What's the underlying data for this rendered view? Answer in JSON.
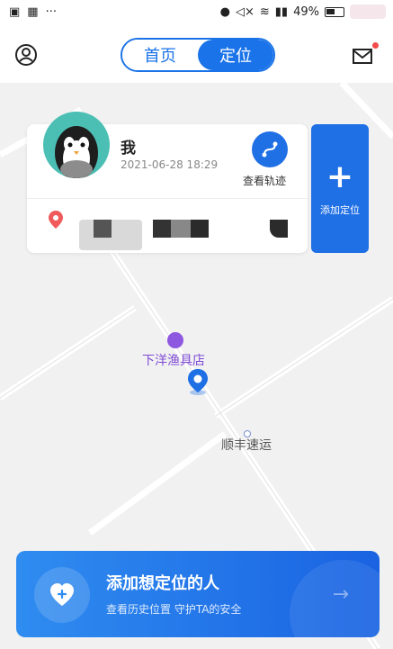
{
  "status_bar": {
    "battery": "49%"
  },
  "header": {
    "tabs": [
      {
        "label": "首页",
        "active": false
      },
      {
        "label": "定位",
        "active": true
      }
    ],
    "icons": {
      "left": "user-circle-icon",
      "right": "mail-icon"
    }
  },
  "card": {
    "name": "我",
    "time": "2021-06-28 18:29",
    "track_label": "查看轨迹"
  },
  "add_location": {
    "label": "添加定位"
  },
  "map": {
    "poi_store": "下洋渔具店",
    "poi_express": "顺丰速运"
  },
  "banner": {
    "title": "添加想定位的人",
    "subtitle": "查看历史位置 守护TA的安全"
  },
  "colors": {
    "accent": "#1a73e8",
    "button_blue": "#1f6fe5",
    "poi_purple": "#7f4ad6"
  }
}
